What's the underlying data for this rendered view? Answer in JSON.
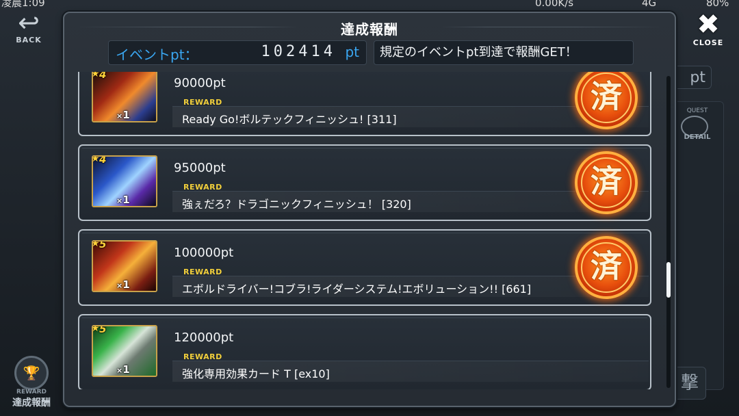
{
  "status_bar": {
    "time": "凌晨1:09",
    "network_speed": "0.00K/s",
    "signal": "4G",
    "battery": "80%"
  },
  "background": {
    "back_label": "BACK",
    "close_label": "CLOSE",
    "pt_suffix": "pt",
    "quest_label": "QUEST",
    "detail_label": "DETAIL",
    "side_reward_label": "REWARD",
    "side_reward_title": "達成報酬",
    "side_btn_glyph": "撃"
  },
  "dialog": {
    "title": "達成報酬",
    "event_pt_label": "イベントpt：",
    "event_pt_value": "102414",
    "event_pt_unit": "pt",
    "info_text": "規定のイベントpt到達で報酬GET！",
    "reward_tag": "REWARD",
    "claimed_stamp": "済",
    "rows": [
      {
        "threshold": "90000pt",
        "reward": "Ready Go!ボルテックフィニッシュ! [311]",
        "stars": "4",
        "qty": "1",
        "claimed": true,
        "art_color": "#c0392b"
      },
      {
        "threshold": "95000pt",
        "reward": "強ぇだろ？ドラゴニックフィニッシュ！ [320]",
        "stars": "4",
        "qty": "1",
        "claimed": true,
        "art_color": "#2d6fd6"
      },
      {
        "threshold": "100000pt",
        "reward": "エボルドライバー!コブラ!ライダーシステム!エボリューション!! [661]",
        "stars": "5",
        "qty": "1",
        "claimed": true,
        "art_color": "#e2862a"
      },
      {
        "threshold": "120000pt",
        "reward": "強化専用効果カード T [ex10]",
        "stars": "5",
        "qty": "1",
        "claimed": false,
        "art_color": "#34a853"
      }
    ]
  },
  "scroll": {
    "position": 0.62
  }
}
